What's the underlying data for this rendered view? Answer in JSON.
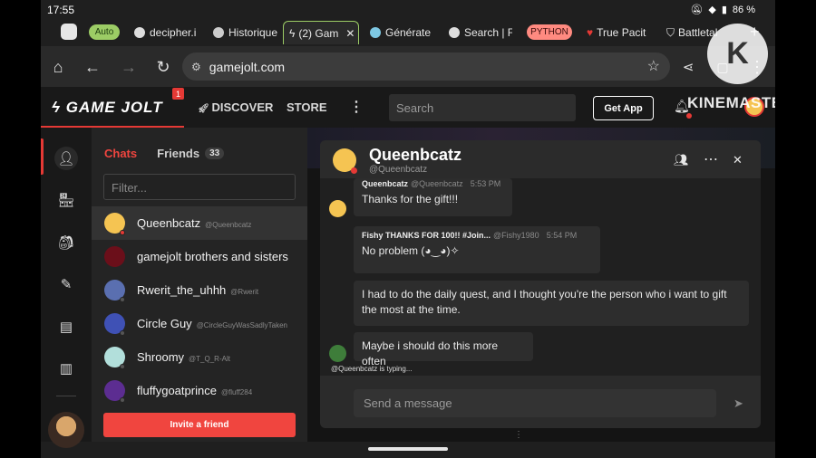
{
  "status": {
    "time": "17:55",
    "battery": "86 %"
  },
  "tabs": [
    {
      "label": "Auto",
      "kind": "chip"
    },
    {
      "label": "decipher.i"
    },
    {
      "label": "Historique"
    },
    {
      "label": "(2) Gam"
    },
    {
      "label": "Générate"
    },
    {
      "label": "Search | F"
    },
    {
      "label": "PYTHON",
      "kind": "chip"
    },
    {
      "label": "True Pacit"
    },
    {
      "label": "Battletal"
    }
  ],
  "browser": {
    "url": "gamejolt.com"
  },
  "gj": {
    "logo": "GAME JOLT",
    "logo_badge": "1",
    "discover": "DISCOVER",
    "store": "STORE",
    "search_placeholder": "Search",
    "get_app": "Get App"
  },
  "chats_panel": {
    "tab_chats": "Chats",
    "tab_friends": "Friends",
    "friends_count": "33",
    "filter_placeholder": "Filter...",
    "invite": "Invite a friend",
    "rows": [
      {
        "name": "Queenbcatz",
        "user": "@Queenbcatz"
      },
      {
        "name": "gamejolt brothers and sisters",
        "user": ""
      },
      {
        "name": "Rwerit_the_uhhh",
        "user": "@Rwerit"
      },
      {
        "name": "Circle Guy",
        "user": "@CircleGuyWasSadlyTaken"
      },
      {
        "name": "Shroomy",
        "user": "@T_Q_R-Alt"
      },
      {
        "name": "fluffygoatprince",
        "user": "@fluff284"
      }
    ]
  },
  "chat": {
    "name": "Queenbcatz",
    "user": "@Queenbcatz",
    "messages": [
      {
        "author": "Queenbcatz",
        "user": "@Queenbcatz",
        "time": "5:53 PM",
        "text": "Thanks for the gift!!!"
      },
      {
        "author": "Fishy THANKS FOR 100!! #Join...",
        "user": "@Fishy1980",
        "time": "5:54 PM",
        "text": "No problem (◕‿◕)✧"
      },
      {
        "author": "",
        "user": "",
        "time": "",
        "text": "I had to do the daily quest, and I thought you're the person who i want to gift the most at the time."
      },
      {
        "author": "",
        "user": "",
        "time": "",
        "text": "Maybe i should do this more often"
      }
    ],
    "typing": "@Queenbcatz is typing...",
    "composer_placeholder": "Send a message"
  },
  "watermark": {
    "text": "KINEMASTER",
    "logo_letter": "K"
  }
}
